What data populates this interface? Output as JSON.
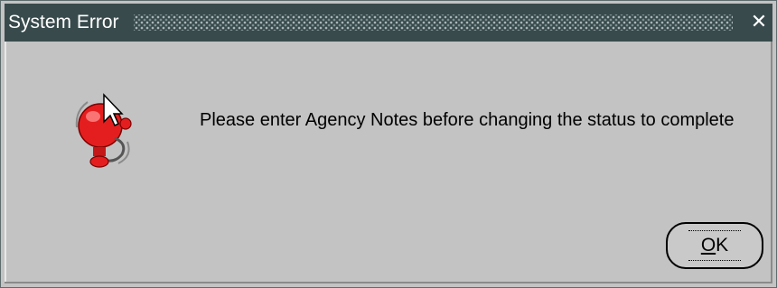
{
  "window": {
    "title": "System Error",
    "close_glyph": "✕"
  },
  "alert": {
    "icon": "alarm-bell-icon",
    "message": "Please enter Agency Notes before changing the status to complete"
  },
  "buttons": {
    "ok_mnemonic": "O",
    "ok_rest": "K"
  },
  "colors": {
    "titlebar_bg": "#384a4c",
    "dialog_bg": "#c3c3c3",
    "bell_red": "#e41e1e"
  }
}
